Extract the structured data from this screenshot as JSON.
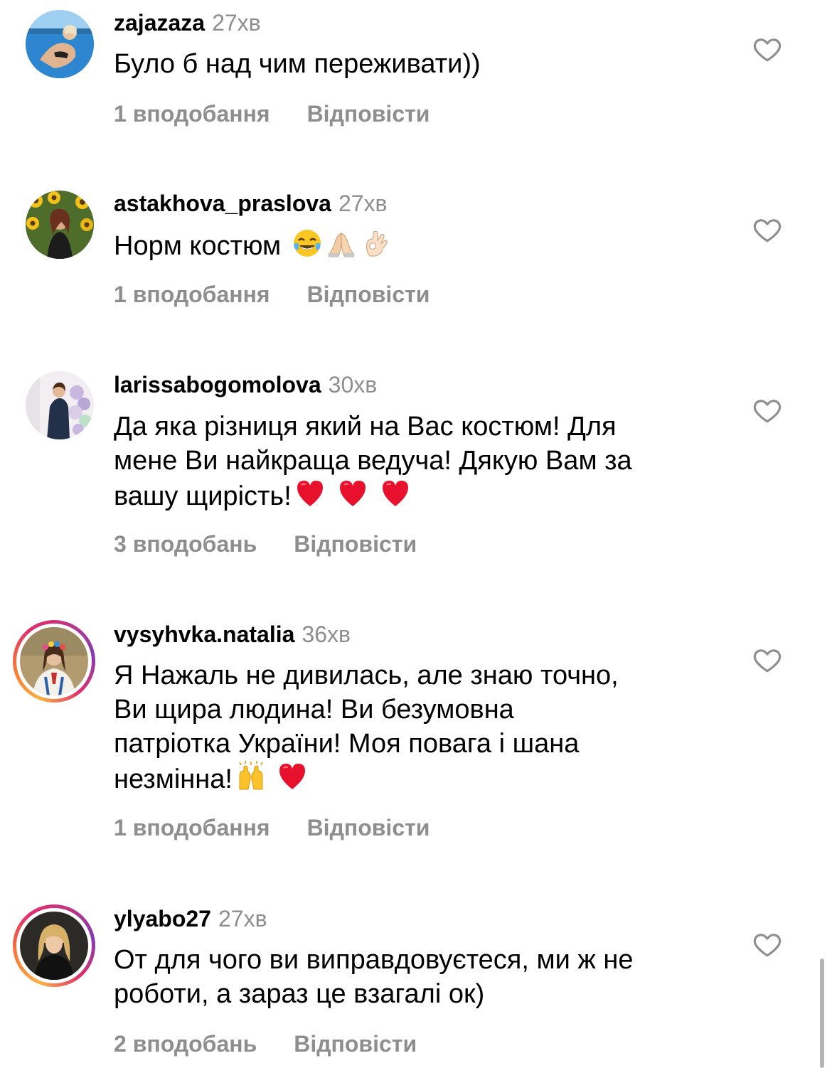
{
  "comments": [
    {
      "username": "zajazaza",
      "time": "27хв",
      "text": "Було б над чим переживати))",
      "likes": "1 вподобання",
      "reply": "Відповісти",
      "avatar": "pool-photo",
      "story_ring": false
    },
    {
      "username": "astakhova_praslova",
      "time": "27хв",
      "text": "Норм костюм ",
      "emojis": [
        "face-with-tears-of-joy-emoji",
        "folded-hands-emoji",
        "ok-hand-emoji"
      ],
      "likes": "1 вподобання",
      "reply": "Відповісти",
      "avatar": "sunflower-field-photo",
      "story_ring": false
    },
    {
      "username": "larissabogomolova",
      "time": "30хв",
      "text_lines": [
        "Да яка різниця який на Вас костюм! Для",
        "мене Ви найкраща ведуча! Дякую Вам за",
        "вашу щирість!"
      ],
      "emojis": [
        "red-heart-emoji",
        "red-heart-emoji",
        "red-heart-emoji"
      ],
      "likes": "3 вподобань",
      "reply": "Відповісти",
      "avatar": "balloons-photo",
      "story_ring": false
    },
    {
      "username": "vysyhvka.natalia",
      "time": "36хв",
      "text_lines": [
        "Я Нажаль не дивилась, але знаю точно,",
        "Ви щира людина! Ви безумовна",
        "патріотка України! Моя повага і шана",
        "незмінна!"
      ],
      "emojis": [
        "raising-hands-emoji",
        "red-heart-emoji"
      ],
      "likes": "1 вподобання",
      "reply": "Відповісти",
      "avatar": "vyshyvanka-portrait",
      "story_ring": true
    },
    {
      "username": "ylyabo27",
      "time": "27хв",
      "text_lines": [
        "От для чого ви виправдовуєтеся, ми ж не",
        "роботи, а зараз це взагалі ок)"
      ],
      "likes": "2 вподобань",
      "reply": "Відповісти",
      "avatar": "blonde-portrait",
      "story_ring": true
    }
  ],
  "colors": {
    "secondary_text": "#8e8e8e",
    "primary_text": "#000000",
    "heart_emoji": "#e8112d",
    "story_ring": [
      "#fcaf45",
      "#e1306c",
      "#833ab4"
    ]
  }
}
